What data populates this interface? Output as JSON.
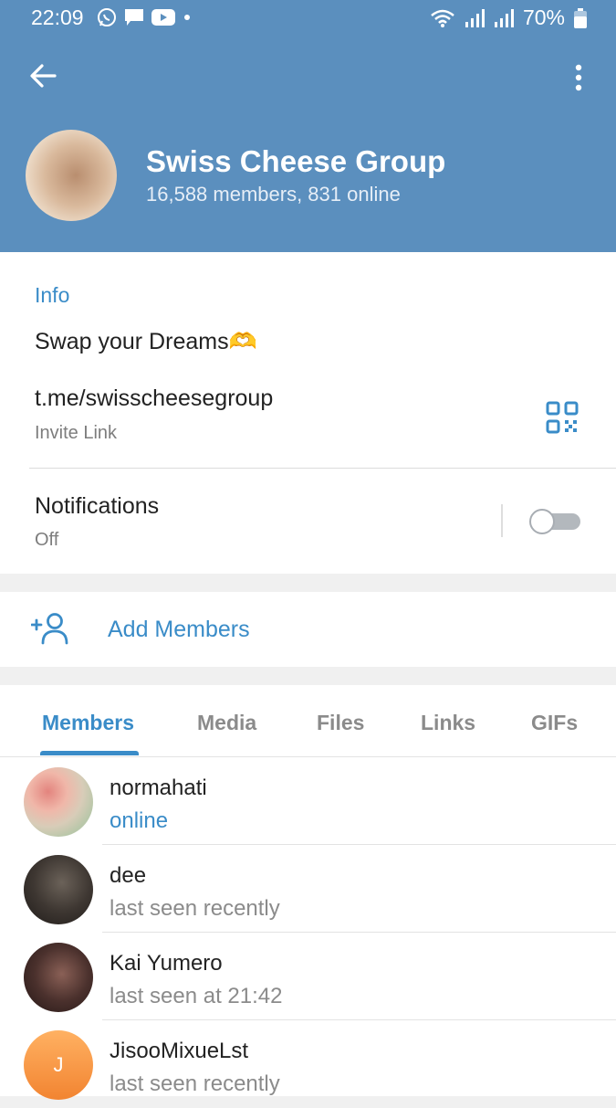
{
  "status_bar": {
    "time": "22:09",
    "battery": "70%"
  },
  "header": {
    "title": "Swiss Cheese Group",
    "subtitle": "16,588 members, 831 online",
    "background_color": "#5b8fbe"
  },
  "info": {
    "heading": "Info",
    "description": "Swap your Dreams🫶",
    "link": "t.me/swisscheesegroup",
    "link_caption": "Invite Link",
    "notifications_label": "Notifications",
    "notifications_status": "Off",
    "notifications_enabled": false
  },
  "add_members": {
    "label": "Add Members"
  },
  "tabs": [
    {
      "label": "Members",
      "active": true
    },
    {
      "label": "Media",
      "active": false
    },
    {
      "label": "Files",
      "active": false
    },
    {
      "label": "Links",
      "active": false
    },
    {
      "label": "GIFs",
      "active": false
    }
  ],
  "members": [
    {
      "name": "normahati",
      "status": "online"
    },
    {
      "name": "dee",
      "status": "last seen recently"
    },
    {
      "name": "Kai Yumero",
      "status": "last seen at 21:42"
    },
    {
      "name": "JisooMixueLst",
      "status": "last seen recently",
      "initial": "J"
    }
  ],
  "colors": {
    "accent": "#3a8cc8",
    "header": "#5b8fbe"
  }
}
